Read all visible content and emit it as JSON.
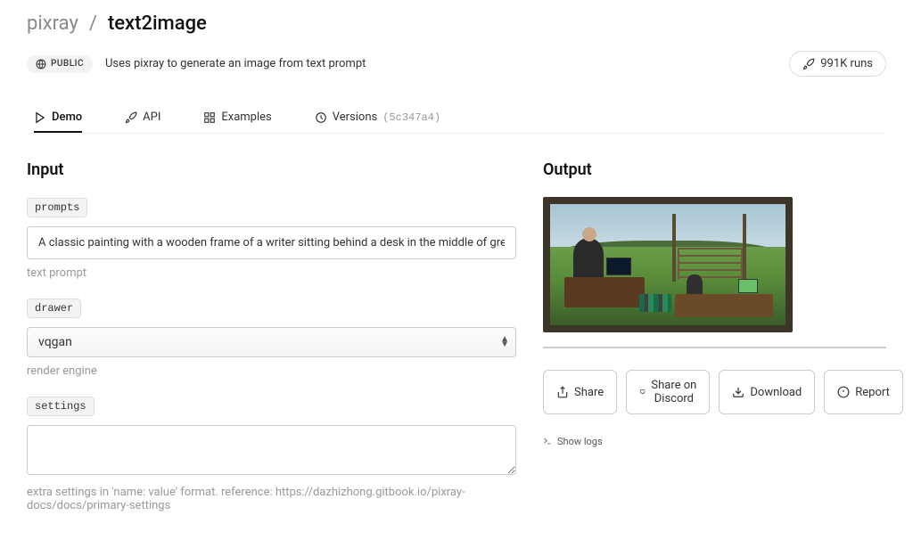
{
  "breadcrumb": {
    "owner": "pixray",
    "model": "text2image"
  },
  "badge": {
    "public": "PUBLIC"
  },
  "description": "Uses pixray to generate an image from text prompt",
  "runs": "991K runs",
  "tabs": {
    "demo": "Demo",
    "api": "API",
    "examples": "Examples",
    "versions": "Versions",
    "version_hash": "(5c347a4)"
  },
  "input": {
    "title": "Input",
    "prompts": {
      "label": "prompts",
      "value": "A classic painting with a wooden frame of a writer sitting behind a desk in the middle of green mid",
      "help": "text prompt"
    },
    "drawer": {
      "label": "drawer",
      "value": "vqgan",
      "help": "render engine"
    },
    "settings": {
      "label": "settings",
      "value": "",
      "help": "extra settings in 'name: value' format. reference: https://dazhizhong.gitbook.io/pixray-docs/docs/primary-settings"
    }
  },
  "output": {
    "title": "Output",
    "actions": {
      "share": "Share",
      "share_discord": "Share on Discord",
      "download": "Download",
      "report": "Report"
    },
    "show_logs": "Show logs"
  }
}
